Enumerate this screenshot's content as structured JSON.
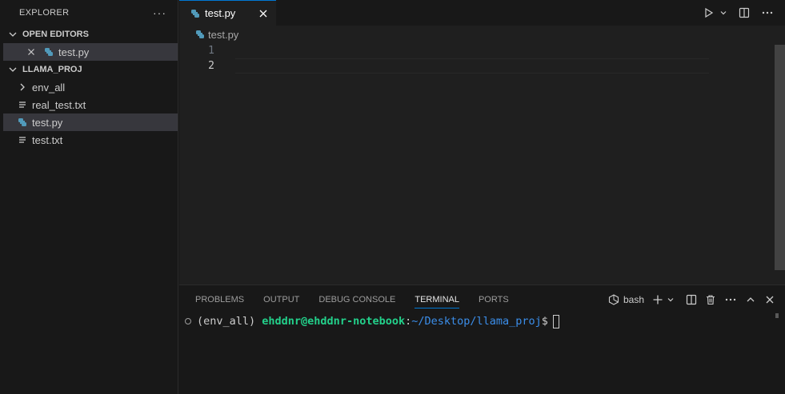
{
  "explorer": {
    "title": "EXPLORER",
    "more": "···",
    "open_editors": {
      "label": "OPEN EDITORS",
      "items": [
        {
          "name": "test.py"
        }
      ]
    },
    "project": {
      "label": "LLAMA_PROJ",
      "items": [
        {
          "name": "env_all",
          "kind": "folder"
        },
        {
          "name": "real_test.txt",
          "kind": "text"
        },
        {
          "name": "test.py",
          "kind": "python"
        },
        {
          "name": "test.txt",
          "kind": "text"
        }
      ]
    }
  },
  "editor": {
    "tab": {
      "label": "test.py"
    },
    "breadcrumb": "test.py",
    "line_numbers": [
      "1",
      "2"
    ]
  },
  "panel": {
    "tabs": [
      "PROBLEMS",
      "OUTPUT",
      "DEBUG CONSOLE",
      "TERMINAL",
      "PORTS"
    ],
    "active_tab": "TERMINAL",
    "shell": "bash",
    "terminal": {
      "env": "(env_all) ",
      "user_host": "ehddnr@ehddnr-notebook",
      "colon": ":",
      "path": "~/Desktop/llama_proj",
      "prompt": "$"
    }
  },
  "colors": {
    "accent": "#0078d4",
    "python_icon": "#519aba",
    "terminal_user": "#23d18b",
    "terminal_path": "#3b8eea"
  }
}
